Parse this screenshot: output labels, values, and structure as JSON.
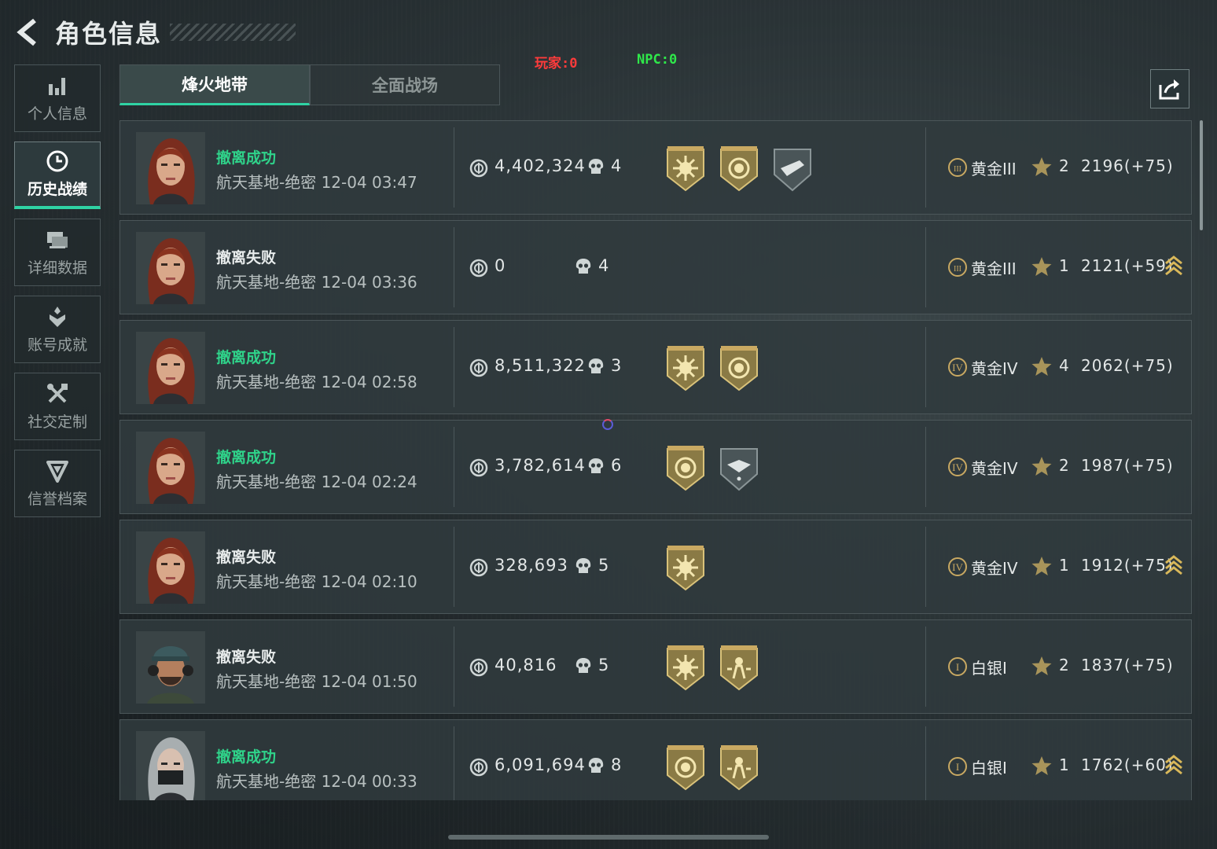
{
  "header": {
    "title": "角色信息"
  },
  "counters": {
    "player": "玩家:0",
    "npc": "NPC:0"
  },
  "sidebar": {
    "items": [
      {
        "label": "个人信息",
        "icon": "bar-chart-icon",
        "active": false
      },
      {
        "label": "历史战绩",
        "icon": "clock-icon",
        "active": true
      },
      {
        "label": "详细数据",
        "icon": "cards-icon",
        "active": false
      },
      {
        "label": "账号成就",
        "icon": "achievement-icon",
        "active": false
      },
      {
        "label": "社交定制",
        "icon": "tools-icon",
        "active": false
      },
      {
        "label": "信誉档案",
        "icon": "shield-icon",
        "active": false
      }
    ]
  },
  "tabs": [
    {
      "label": "烽火地带",
      "active": true
    },
    {
      "label": "全面战场",
      "active": false
    }
  ],
  "records": [
    {
      "outcome": "撤离成功",
      "map": "航天基地-绝密",
      "time": "12-04 03:47",
      "value": "4,402,324",
      "kills": "4",
      "medals": [
        "sun-medal-icon",
        "coin-medal-icon",
        "gun-badge-icon"
      ],
      "rank_icon": "III",
      "rank": "黄金III",
      "stars": "2",
      "score": "2196(+75)",
      "promo": false,
      "avatar": "red-hair"
    },
    {
      "outcome": "撤离失败",
      "map": "航天基地-绝密",
      "time": "12-04 03:36",
      "value": "0",
      "kills": "4",
      "medals": [],
      "rank_icon": "III",
      "rank": "黄金III",
      "stars": "1",
      "score": "2121(+59)",
      "promo": true,
      "avatar": "red-hair"
    },
    {
      "outcome": "撤离成功",
      "map": "航天基地-绝密",
      "time": "12-04 02:58",
      "value": "8,511,322",
      "kills": "3",
      "medals": [
        "sun-medal-icon",
        "coin-medal-icon"
      ],
      "rank_icon": "IV",
      "rank": "黄金IV",
      "stars": "4",
      "score": "2062(+75)",
      "promo": false,
      "avatar": "red-hair"
    },
    {
      "outcome": "撤离成功",
      "map": "航天基地-绝密",
      "time": "12-04 02:24",
      "value": "3,782,614",
      "kills": "6",
      "medals": [
        "coin-medal-icon",
        "handshake-badge-icon"
      ],
      "rank_icon": "IV",
      "rank": "黄金IV",
      "stars": "2",
      "score": "1987(+75)",
      "promo": false,
      "avatar": "red-hair"
    },
    {
      "outcome": "撤离失败",
      "map": "航天基地-绝密",
      "time": "12-04 02:10",
      "value": "328,693",
      "kills": "5",
      "medals": [
        "sun-medal-icon"
      ],
      "rank_icon": "IV",
      "rank": "黄金IV",
      "stars": "1",
      "score": "1912(+75)",
      "promo": true,
      "avatar": "red-hair"
    },
    {
      "outcome": "撤离失败",
      "map": "航天基地-绝密",
      "time": "12-04 01:50",
      "value": "40,816",
      "kills": "5",
      "medals": [
        "sun-medal-icon",
        "soldier-medal-icon"
      ],
      "rank_icon": "I",
      "rank": "白银I",
      "stars": "2",
      "score": "1837(+75)",
      "promo": false,
      "avatar": "soldier"
    },
    {
      "outcome": "撤离成功",
      "map": "航天基地-绝密",
      "time": "12-04 00:33",
      "value": "6,091,694",
      "kills": "8",
      "medals": [
        "coin-medal-icon",
        "soldier-medal-icon"
      ],
      "rank_icon": "I",
      "rank": "白银I",
      "stars": "1",
      "score": "1762(+60)",
      "promo": true,
      "avatar": "masked"
    }
  ],
  "colors": {
    "accent": "#2fd3a4",
    "success": "#2fd38a",
    "gold": "#c9a962",
    "player_counter": "#ff3b3b",
    "npc_counter": "#2fe84a"
  }
}
